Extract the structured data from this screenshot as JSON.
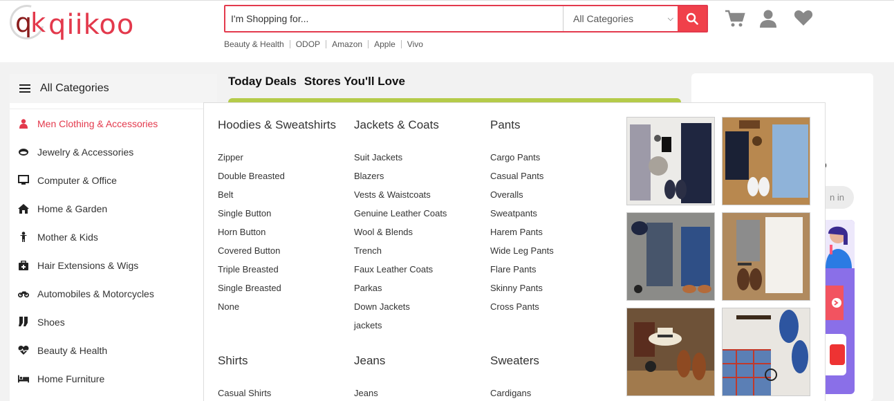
{
  "header": {
    "logo_text": "qiikoo",
    "logo_mark": "qk",
    "search": {
      "placeholder": "I'm Shopping for...",
      "category_select": "All Categories"
    },
    "quick_links": [
      "Beauty & Health",
      "ODOP",
      "Amazon",
      "Apple",
      "Vivo"
    ],
    "icons": [
      "cart-icon",
      "user-icon",
      "heart-icon"
    ]
  },
  "sidebar": {
    "title": "All Categories",
    "items": [
      {
        "label": "Men Clothing & Accessories",
        "icon": "person-icon",
        "active": true
      },
      {
        "label": "Jewelry & Accessories",
        "icon": "ring-icon"
      },
      {
        "label": "Computer & Office",
        "icon": "monitor-icon"
      },
      {
        "label": "Home & Garden",
        "icon": "home-icon"
      },
      {
        "label": "Mother & Kids",
        "icon": "child-icon"
      },
      {
        "label": "Hair Extensions & Wigs",
        "icon": "medkit-icon"
      },
      {
        "label": "Automobiles & Motorcycles",
        "icon": "motorcycle-icon"
      },
      {
        "label": "Shoes",
        "icon": "socks-icon"
      },
      {
        "label": "Beauty & Health",
        "icon": "heartbeat-icon"
      },
      {
        "label": "Home Furniture",
        "icon": "bed-icon"
      }
    ]
  },
  "tabs": [
    "Today Deals",
    "Stores You'll Love"
  ],
  "right_panel": {
    "partial_text": "o",
    "partial_button": "n in"
  },
  "mega_menu": {
    "columns": [
      {
        "title": "Hoodies & Sweatshirts",
        "items": [
          "Zipper",
          "Double Breasted",
          "Belt",
          "Single Button",
          "Horn Button",
          "Covered Button",
          "Triple Breasted",
          "Single Breasted",
          "None"
        ]
      },
      {
        "title": "Jackets & Coats",
        "items": [
          "Suit Jackets",
          "Blazers",
          "Vests & Waistcoats",
          "Genuine Leather Coats",
          "Wool & Blends",
          "Trench",
          "Faux Leather Coats",
          "Parkas",
          "Down Jackets",
          "jackets"
        ]
      },
      {
        "title": "Pants",
        "items": [
          "Cargo Pants",
          "Casual Pants",
          "Overalls",
          "Sweatpants",
          "Harem Pants",
          "Wide Leg Pants",
          "Flare Pants",
          "Skinny Pants",
          "Cross Pants"
        ]
      },
      {
        "title": "Shirts",
        "items": [
          "Casual Shirts"
        ]
      },
      {
        "title": "Jeans",
        "items": [
          "Jeans"
        ]
      },
      {
        "title": "Sweaters",
        "items": [
          "Cardigans"
        ]
      }
    ]
  },
  "colors": {
    "accent": "#e3394c",
    "search_button": "#f0404a",
    "promo": "#8a6fe8"
  }
}
